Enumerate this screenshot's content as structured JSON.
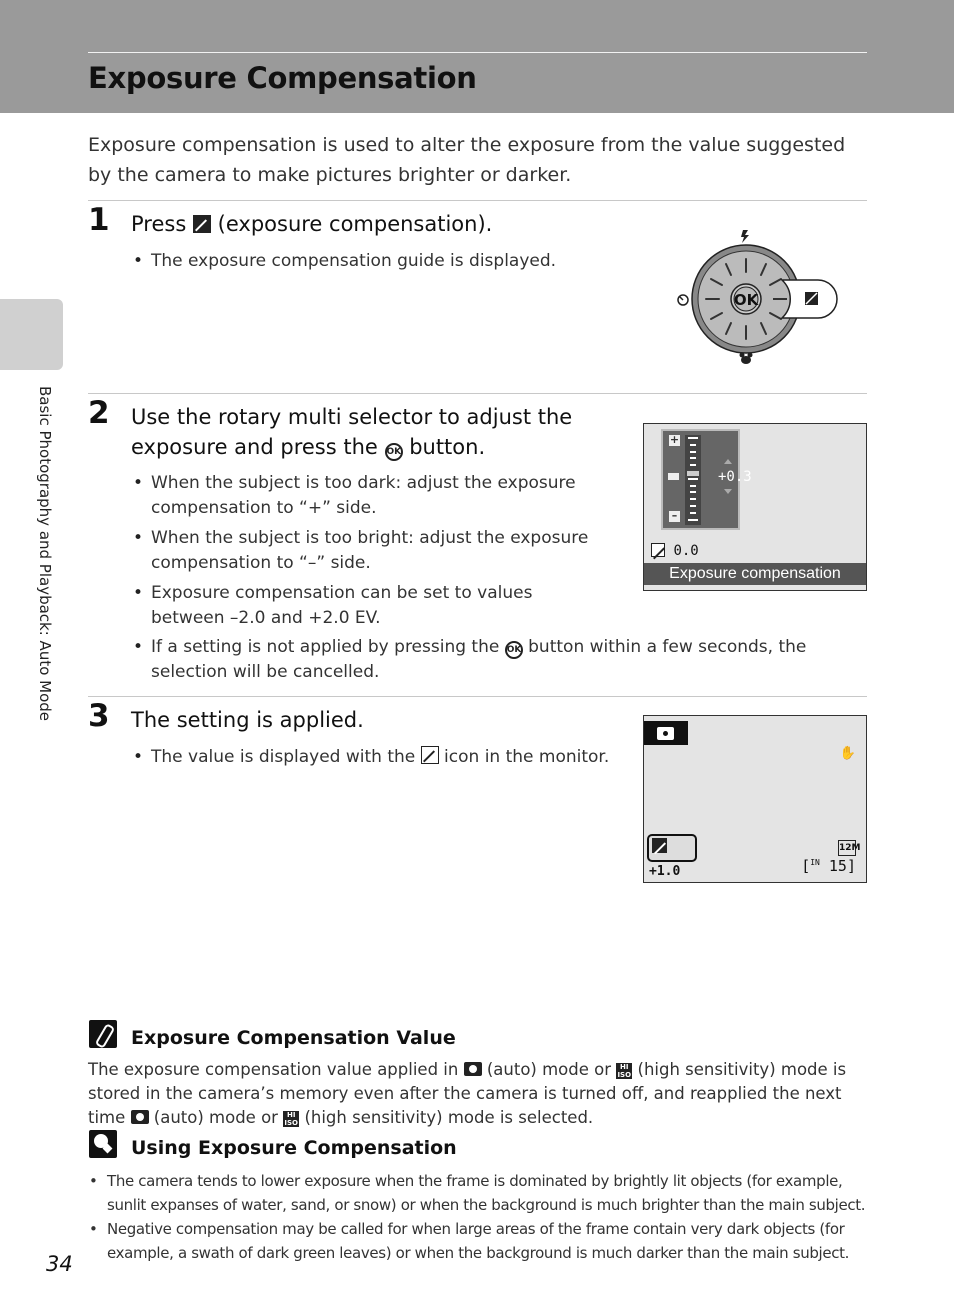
{
  "header": {
    "title": "Exposure Compensation"
  },
  "side": {
    "chapter_label": "Basic Photography and Playback: Auto Mode"
  },
  "intro": "Exposure compensation is used to alter the exposure from the value suggested by the camera to make pictures brighter or darker.",
  "steps": [
    {
      "number": "1",
      "title_before": "Press",
      "title_icon": "exposure-compensation-icon",
      "title_after": "(exposure compensation).",
      "bullets": [
        "The exposure compensation guide is displayed."
      ]
    },
    {
      "number": "2",
      "title_line1": "Use the rotary multi selector to adjust the",
      "title_line2_before": "exposure and press the",
      "title_icon": "ok-button-icon",
      "title_line2_after": "button.",
      "bullets": [
        "When the subject is too dark: adjust the exposure compensation to “+” side.",
        "When the subject is too bright: adjust the exposure compensation to “–” side.",
        "Exposure compensation can be set to values between –2.0 and +2.0 EV."
      ],
      "wide_bullet_before": "If a setting is not applied by pressing the",
      "wide_bullet_icon": "ok-button-icon",
      "wide_bullet_after": "button within a few seconds, the selection will be cancelled."
    },
    {
      "number": "3",
      "title": "The setting is applied.",
      "bullet_before": "The value is displayed with the",
      "bullet_icon": "exposure-compensation-icon",
      "bullet_after": "icon in the monitor."
    }
  ],
  "dial": {
    "center_label": "OK",
    "top_icon": "flash-icon",
    "left_icon": "self-timer-icon",
    "right_icon": "exposure-compensation-icon",
    "bottom_icon": "macro-icon"
  },
  "screen1": {
    "selected_value": "+0.3",
    "current_value": "0.0",
    "caption": "Exposure compensation",
    "plus": "+",
    "minus": "–",
    "range_ev": [
      -2.0,
      2.0
    ]
  },
  "screen2": {
    "ev_value": "+1.0",
    "image_size": "12M",
    "memory": "IN",
    "exposures_remaining": "15"
  },
  "notes": [
    {
      "icon": "pencil-note-icon",
      "title": "Exposure Compensation Value",
      "p1": "The exposure compensation value applied in",
      "i1": "(auto) mode or",
      "i2": "(high sensitivity) mode is stored in the camera’s memory even after the camera is turned off, and reapplied the next time",
      "i3": "(auto) mode or",
      "i4": "(high sensitivity) mode is selected."
    },
    {
      "icon": "tip-lightbulb-icon",
      "title": "Using Exposure Compensation",
      "bullets": [
        "The camera tends to lower exposure when the frame is dominated by brightly lit objects (for example, sunlit expanses of water, sand, or snow) or when the background is much brighter than the main subject.",
        "Negative compensation may be called for when large areas of the frame contain very dark objects (for example, a swath of dark green leaves) or when the background is much darker than the main subject."
      ]
    }
  ],
  "page_number": "34"
}
